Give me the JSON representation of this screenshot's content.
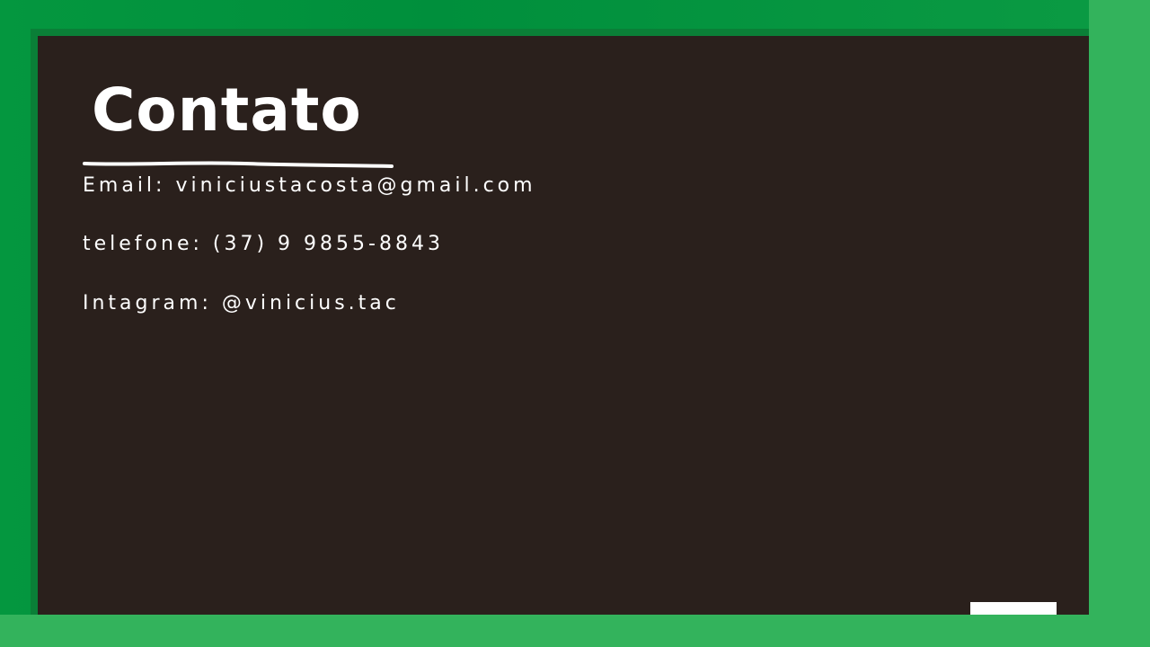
{
  "slide": {
    "title": "Contato",
    "contacts": [
      {
        "text": "Email: viniciustacosta@gmail.com"
      },
      {
        "text": "telefone: (37) 9 9855-8843"
      },
      {
        "text": "Intagram: @vinicius.tac"
      }
    ]
  },
  "colors": {
    "board": "#2a201c",
    "frame_dark": "#008f3c",
    "frame_light": "#33b35c",
    "chalk": "#ffffff"
  }
}
